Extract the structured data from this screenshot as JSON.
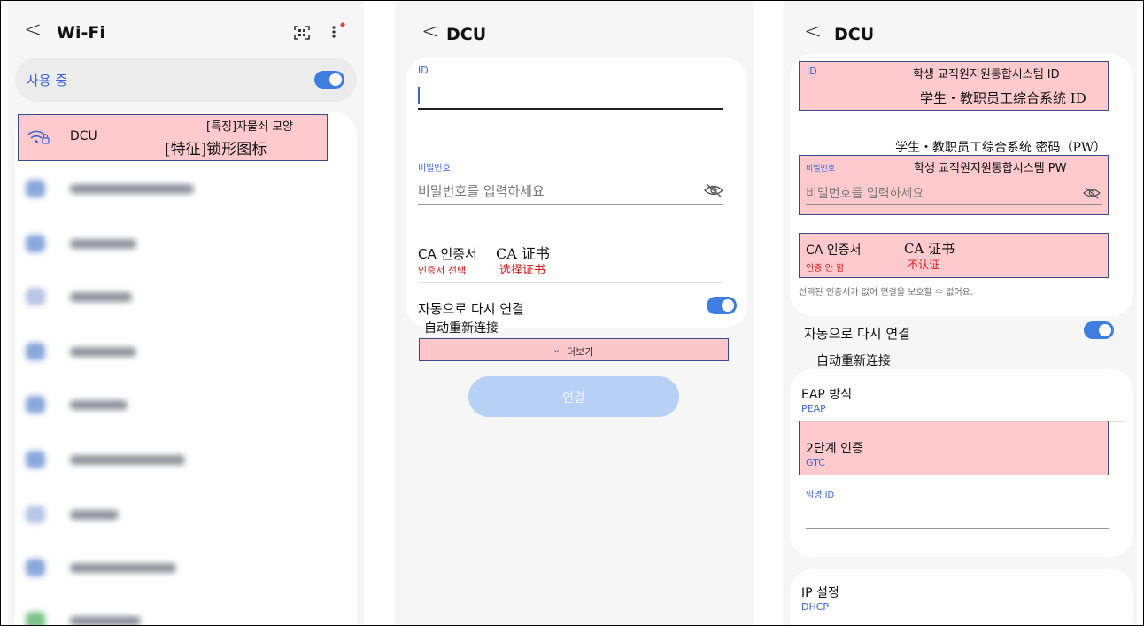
{
  "wifi": {
    "back": "<",
    "title": "Wi-Fi",
    "in_use_label": "사용 중",
    "network_name": "DCU",
    "note_ko": "[특징]자물쇠 모양",
    "note_cn": "[特征]锁形图标"
  },
  "form1": {
    "back": "<",
    "title": "DCU",
    "id_label": "ID",
    "password_label": "비밀번호",
    "password_placeholder": "비밀번호를 입력하세요",
    "ca_label": "CA 인증서",
    "ca_cn": "CA 证书",
    "ca_value": "인증서 선택",
    "ca_value_cn": "选择证书",
    "auto_reconnect": "자동으로 다시 연결",
    "auto_reconnect_cn": "自动重新连接",
    "more": "더보기",
    "connect": "연결"
  },
  "form2": {
    "back": "<",
    "title": "DCU",
    "id_label": "ID",
    "id_note_ko": "학생 교직원지원통합시스템 ID",
    "id_note_cn": "学生・教职员工综合系统 ID",
    "pw_note_cn": "学生・教职员工综合系统 密码（PW）",
    "password_label": "비밀번호",
    "pw_note_ko": "학생 교직원지원통합시스템 PW",
    "password_placeholder": "비밀번호를 입력하세요",
    "ca_label": "CA 인증서",
    "ca_cn": "CA 证书",
    "ca_value": "인증 안 함",
    "ca_value_cn": "不认证",
    "ca_warning": "선택된 인증서가 없어 연결을 보호할 수 없어요.",
    "auto_reconnect": "자동으로 다시 연결",
    "auto_reconnect_cn": "自动重新连接",
    "eap_label": "EAP 방식",
    "eap_value": "PEAP",
    "phase2_label": "2단계 인증",
    "phase2_value": "GTC",
    "anon_label": "익명 ID",
    "ip_label": "IP 설정",
    "ip_value": "DHCP"
  },
  "colors": {
    "accent": "#3f7de0",
    "highlight": "#ffaaaf",
    "highlight_border": "#3a4b8a",
    "annotation_red": "#d21a1a"
  }
}
